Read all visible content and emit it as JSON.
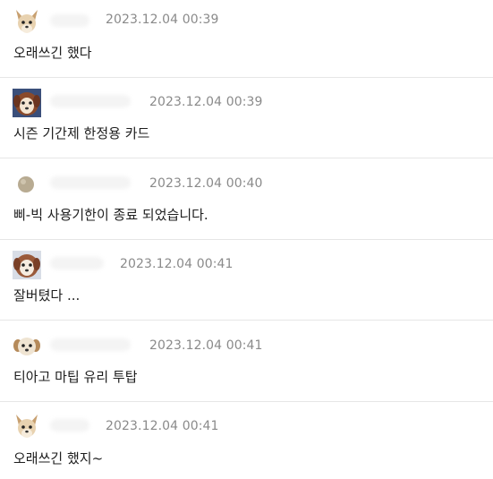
{
  "comments": [
    {
      "avatar": "chihuahua-avatar",
      "time": "2023.12.04 00:39",
      "text": "오래쓰긴 했다"
    },
    {
      "avatar": "dog-face-avatar",
      "time": "2023.12.04 00:39",
      "text": "시즌 기간제 한정용 카드"
    },
    {
      "avatar": "gray-dot-avatar",
      "time": "2023.12.04 00:40",
      "text": "삐-빅 사용기한이 종료 되었습니다."
    },
    {
      "avatar": "dog-face-avatar",
      "time": "2023.12.04 00:41",
      "text": "잘버텼다 ..."
    },
    {
      "avatar": "puppy-avatar",
      "time": "2023.12.04 00:41",
      "text": "티아고 마팁 유리 투탑"
    },
    {
      "avatar": "chihuahua-avatar",
      "time": "2023.12.04 00:41",
      "text": "오래쓰긴 했지~"
    }
  ]
}
